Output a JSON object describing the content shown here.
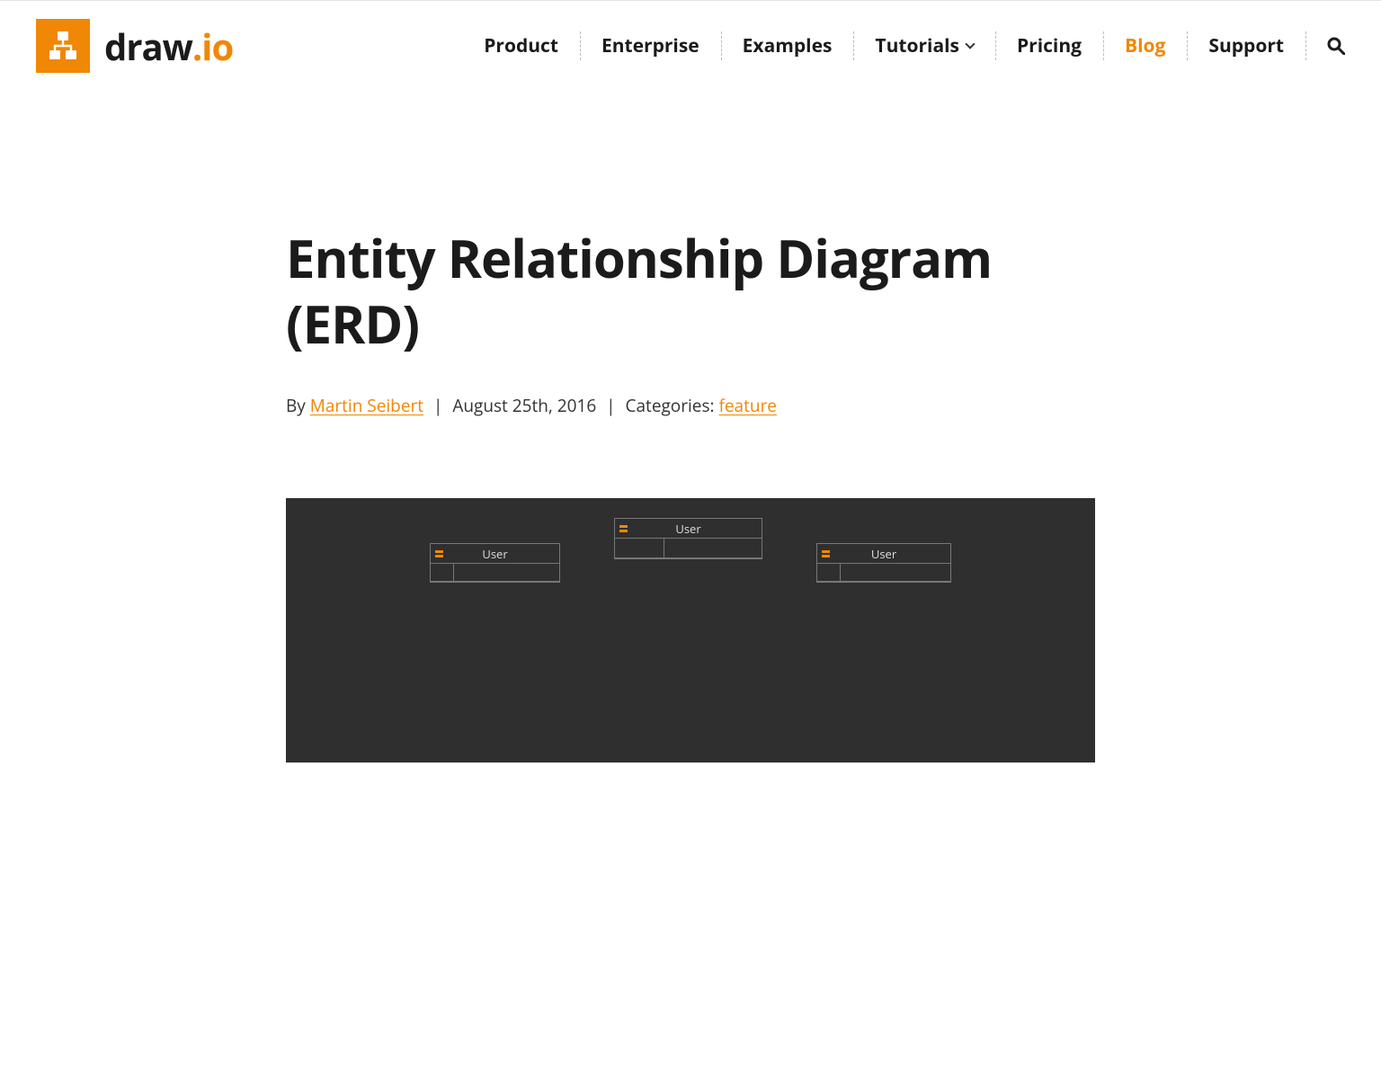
{
  "brand": {
    "name_part1": "draw",
    "name_dot": ".",
    "name_part2": "io"
  },
  "nav": {
    "items": [
      {
        "label": "Product",
        "has_chevron": false,
        "active": false
      },
      {
        "label": "Enterprise",
        "has_chevron": false,
        "active": false
      },
      {
        "label": "Examples",
        "has_chevron": false,
        "active": false
      },
      {
        "label": "Tutorials",
        "has_chevron": true,
        "active": false
      },
      {
        "label": "Pricing",
        "has_chevron": false,
        "active": false
      },
      {
        "label": "Blog",
        "has_chevron": false,
        "active": true
      },
      {
        "label": "Support",
        "has_chevron": false,
        "active": false
      }
    ]
  },
  "article": {
    "title": "Entity Relationship Diagram (ERD)",
    "by_label": "By ",
    "author": "Martin Seibert",
    "date": "August 25th, 2016",
    "categories_label": "Categories: ",
    "category": "feature",
    "separator": "|"
  },
  "figure": {
    "entity_label": "User"
  },
  "colors": {
    "accent": "#f08705",
    "text": "#1b1b1b",
    "figure_bg": "#2f2f2f"
  }
}
